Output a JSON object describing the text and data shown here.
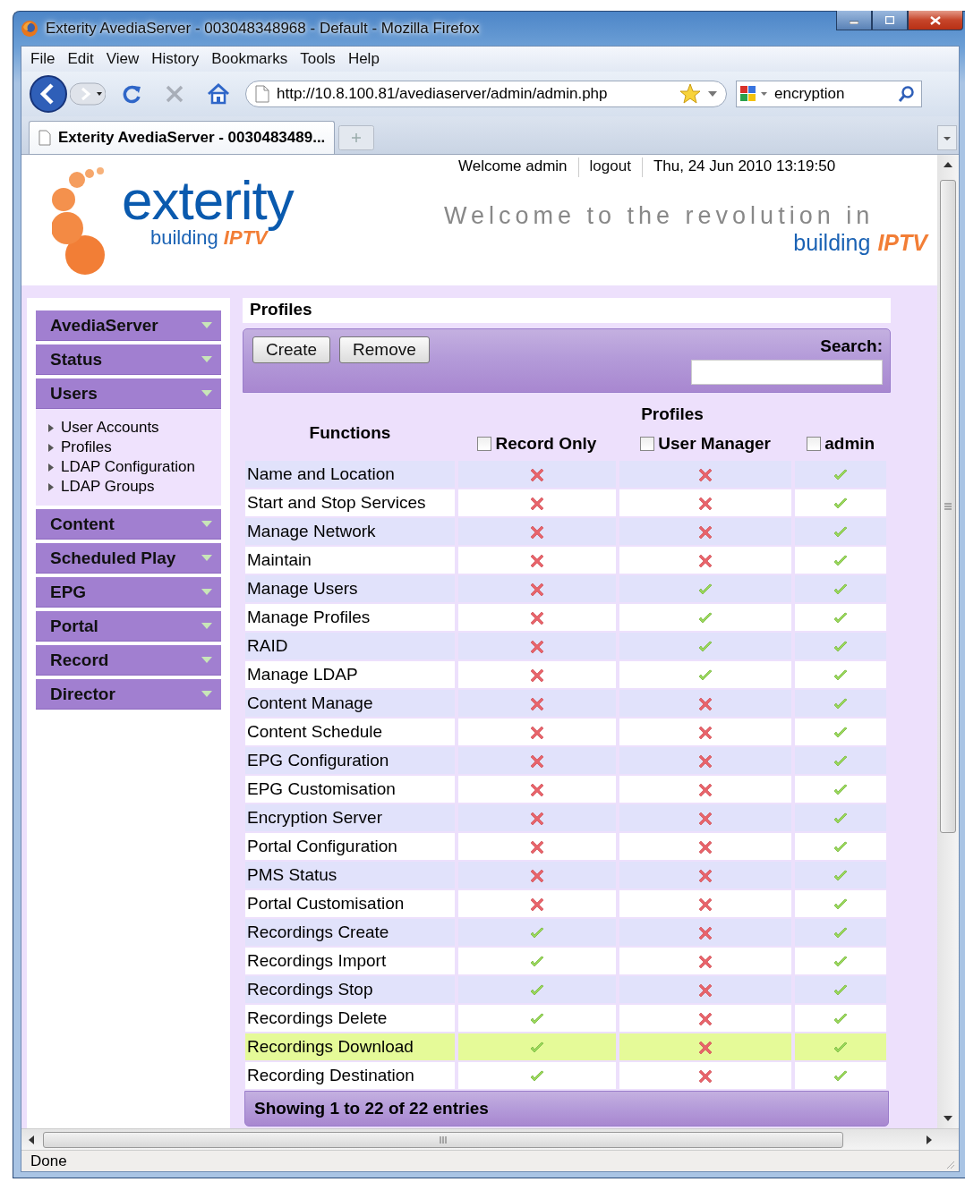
{
  "window": {
    "title": "Exterity AvediaServer - 003048348968 - Default - Mozilla Firefox"
  },
  "menu": [
    "File",
    "Edit",
    "View",
    "History",
    "Bookmarks",
    "Tools",
    "Help"
  ],
  "address_bar": {
    "value": "http://10.8.100.81/avediaserver/admin/admin.php"
  },
  "search_bar": {
    "value": "encryption"
  },
  "tabs": [
    {
      "label": "Exterity AvediaServer - 0030483489...",
      "selected": true
    }
  ],
  "header": {
    "user_links": [
      "Welcome admin",
      "logout",
      "Thu, 24 Jun 2010 13:19:50"
    ],
    "logo": {
      "name": "exterity",
      "tagline": "building",
      "tagline_accent": "IPTV"
    },
    "slogan": {
      "line_1": "Welcome to the revolution in",
      "line_2": "building",
      "line_2_accent": "IPTV"
    }
  },
  "sidebar": {
    "sections": [
      {
        "label": "AvediaServer"
      },
      {
        "label": "Status"
      },
      {
        "label": "Users",
        "items": [
          "User Accounts",
          "Profiles",
          "LDAP Configuration",
          "LDAP Groups"
        ]
      },
      {
        "label": "Content"
      },
      {
        "label": "Scheduled Play"
      },
      {
        "label": "EPG"
      },
      {
        "label": "Portal"
      },
      {
        "label": "Record"
      },
      {
        "label": "Director"
      }
    ]
  },
  "panel": {
    "title": "Profiles",
    "buttons": [
      "Create",
      "Remove"
    ],
    "search_label": "Search:"
  },
  "table": {
    "functions_heading": "Functions",
    "profiles_heading": "Profiles",
    "profiles": [
      {
        "name": "Record Only",
        "checked": false
      },
      {
        "name": "User Manager",
        "checked": false
      },
      {
        "name": "admin",
        "checked": false
      }
    ],
    "rows": [
      {
        "function": "Name and Location",
        "allowed": [
          false,
          false,
          true
        ],
        "highlighted": false
      },
      {
        "function": "Start and Stop Services",
        "allowed": [
          false,
          false,
          true
        ],
        "highlighted": false
      },
      {
        "function": "Manage Network",
        "allowed": [
          false,
          false,
          true
        ],
        "highlighted": false
      },
      {
        "function": "Maintain",
        "allowed": [
          false,
          false,
          true
        ],
        "highlighted": false
      },
      {
        "function": "Manage Users",
        "allowed": [
          false,
          true,
          true
        ],
        "highlighted": false
      },
      {
        "function": "Manage Profiles",
        "allowed": [
          false,
          true,
          true
        ],
        "highlighted": false
      },
      {
        "function": "RAID",
        "allowed": [
          false,
          true,
          true
        ],
        "highlighted": false
      },
      {
        "function": "Manage LDAP",
        "allowed": [
          false,
          true,
          true
        ],
        "highlighted": false
      },
      {
        "function": "Content Manage",
        "allowed": [
          false,
          false,
          true
        ],
        "highlighted": false
      },
      {
        "function": "Content Schedule",
        "allowed": [
          false,
          false,
          true
        ],
        "highlighted": false
      },
      {
        "function": "EPG Configuration",
        "allowed": [
          false,
          false,
          true
        ],
        "highlighted": false
      },
      {
        "function": "EPG Customisation",
        "allowed": [
          false,
          false,
          true
        ],
        "highlighted": false
      },
      {
        "function": "Encryption Server",
        "allowed": [
          false,
          false,
          true
        ],
        "highlighted": false
      },
      {
        "function": "Portal Configuration",
        "allowed": [
          false,
          false,
          true
        ],
        "highlighted": false
      },
      {
        "function": "PMS Status",
        "allowed": [
          false,
          false,
          true
        ],
        "highlighted": false
      },
      {
        "function": "Portal Customisation",
        "allowed": [
          false,
          false,
          true
        ],
        "highlighted": false
      },
      {
        "function": "Recordings Create",
        "allowed": [
          true,
          false,
          true
        ],
        "highlighted": false
      },
      {
        "function": "Recordings Import",
        "allowed": [
          true,
          false,
          true
        ],
        "highlighted": false
      },
      {
        "function": "Recordings Stop",
        "allowed": [
          true,
          false,
          true
        ],
        "highlighted": false
      },
      {
        "function": "Recordings Delete",
        "allowed": [
          true,
          false,
          true
        ],
        "highlighted": false
      },
      {
        "function": "Recordings Download",
        "allowed": [
          true,
          false,
          true
        ],
        "highlighted": true
      },
      {
        "function": "Recording Destination",
        "allowed": [
          true,
          false,
          true
        ],
        "highlighted": false
      }
    ],
    "footer": "Showing 1 to 22 of 22 entries"
  },
  "status_bar": {
    "text": "Done"
  }
}
